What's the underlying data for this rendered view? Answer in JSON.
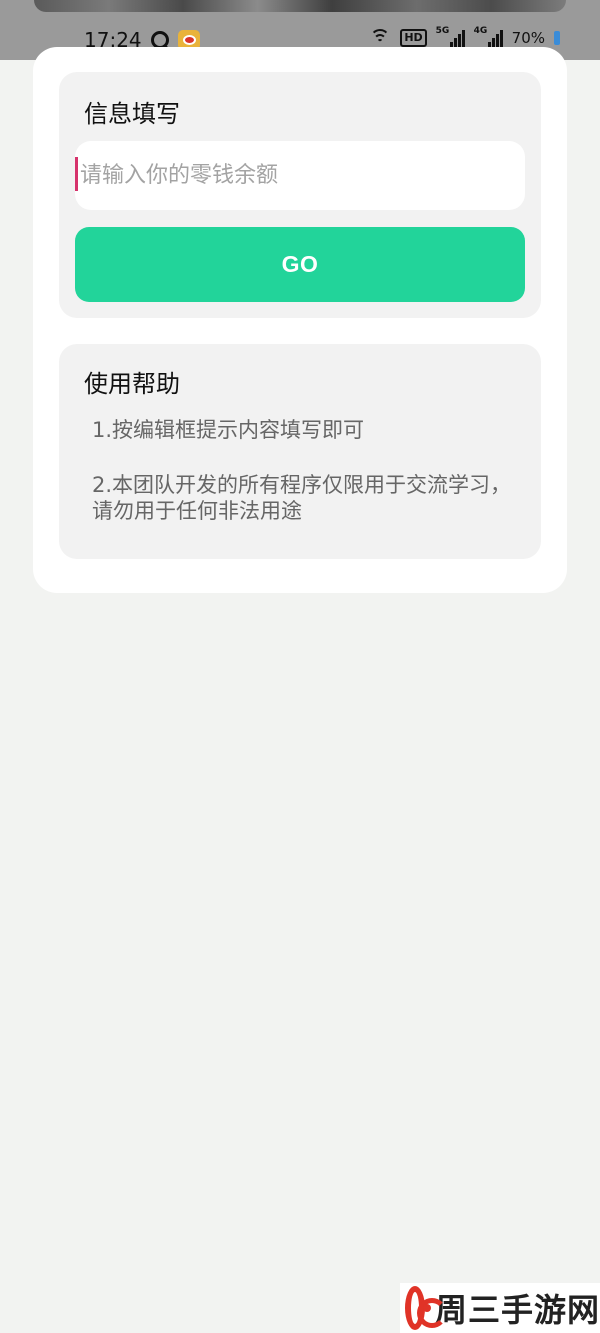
{
  "status_bar": {
    "time": "17:24",
    "icons": [
      "q-icon",
      "weibo-icon",
      "wifi-icon",
      "hd-icon",
      "signal-5g-icon",
      "signal-4g-icon",
      "battery-icon"
    ],
    "hd_label": "HD",
    "sim1_label": "5G",
    "sim2_label": "4G",
    "battery": "70%"
  },
  "info_panel": {
    "title": "信息填写",
    "input_placeholder": "请输入你的零钱余额",
    "input_value": "",
    "go_label": "GO"
  },
  "help_panel": {
    "title": "使用帮助",
    "items": [
      "1.按编辑框提示内容填写即可",
      "2.本团队开发的所有程序仅限用于交流学习，请勿用于任何非法用途"
    ]
  },
  "watermark": {
    "text": "周三手游网"
  },
  "colors": {
    "accent": "#22d49a",
    "background": "#f2f3f1",
    "card": "#ffffff",
    "panel": "#f2f2f2",
    "caret": "#d6336c",
    "watermark_logo": "#e03327"
  }
}
